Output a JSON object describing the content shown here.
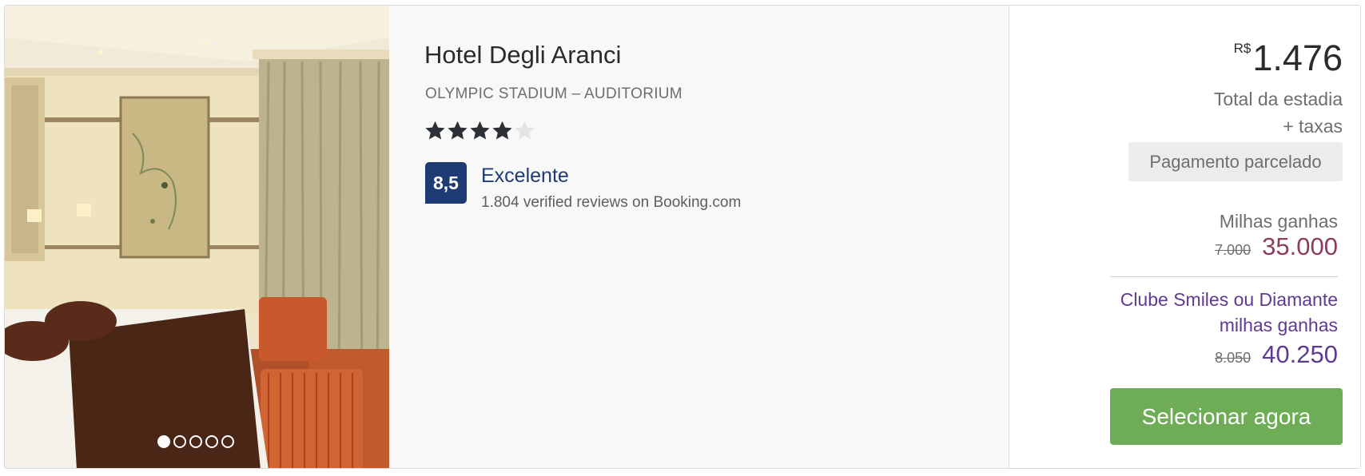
{
  "hotel": {
    "name": "Hotel Degli Aranci",
    "location": "OLYMPIC STADIUM – AUDITORIUM",
    "stars_filled": 4,
    "stars_total": 5,
    "score": "8,5",
    "score_label": "Excelente",
    "reviews": "1.804 verified reviews on Booking.com"
  },
  "gallery": {
    "image_count": 5,
    "active_index": 0
  },
  "pricing": {
    "currency": "R$",
    "amount": "1.476",
    "total_label": "Total da estadia",
    "taxes_label": "+ taxas",
    "installment_label": "Pagamento parcelado"
  },
  "miles": {
    "label": "Milhas ganhas",
    "old_value": "7.000",
    "value": "35.000"
  },
  "club": {
    "label_line1": "Clube Smiles ou Diamante",
    "label_line2": "milhas ganhas",
    "old_value": "8.050",
    "value": "40.250"
  },
  "actions": {
    "select_label": "Selecionar agora"
  },
  "colors": {
    "score_badge": "#1f3b73",
    "miles_value": "#8a3d5e",
    "club_value": "#5f3a8f",
    "select_button": "#6eac56",
    "star_filled": "#2b2f36",
    "star_empty": "#e4e4e4"
  }
}
